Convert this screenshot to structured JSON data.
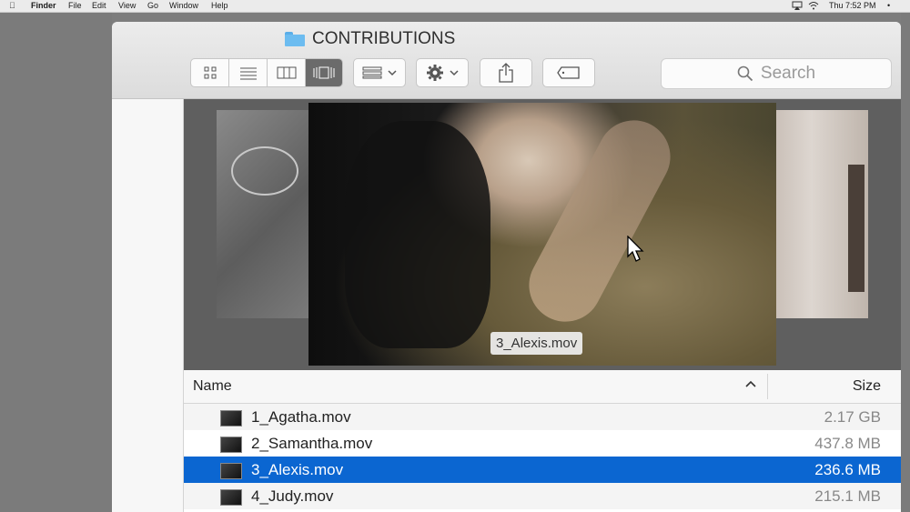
{
  "menubar": {
    "app": "Finder",
    "items": [
      "File",
      "Edit",
      "View",
      "Go",
      "Window",
      "Help"
    ],
    "clock": "Thu 7:52 PM"
  },
  "window": {
    "title": "CONTRIBUTIONS",
    "search_placeholder": "Search"
  },
  "coverflow": {
    "current_label": "3_Alexis.mov"
  },
  "list": {
    "columns": {
      "name": "Name",
      "size": "Size"
    },
    "rows": [
      {
        "name": "1_Agatha.mov",
        "size": "2.17 GB"
      },
      {
        "name": "2_Samantha.mov",
        "size": "437.8 MB"
      },
      {
        "name": "3_Alexis.mov",
        "size": "236.6 MB",
        "selected": true
      },
      {
        "name": "4_Judy.mov",
        "size": "215.1 MB"
      }
    ]
  },
  "colors": {
    "selection": "#0b66d1",
    "folder": "#6cbcf0"
  },
  "icons": {
    "view_icons": "grid-icon",
    "view_list": "list-icon",
    "view_columns": "columns-icon",
    "view_coverflow": "coverflow-icon",
    "arrange": "arrange-icon",
    "action": "gear-icon",
    "share": "share-icon",
    "tags": "tag-icon",
    "search": "search-icon"
  }
}
